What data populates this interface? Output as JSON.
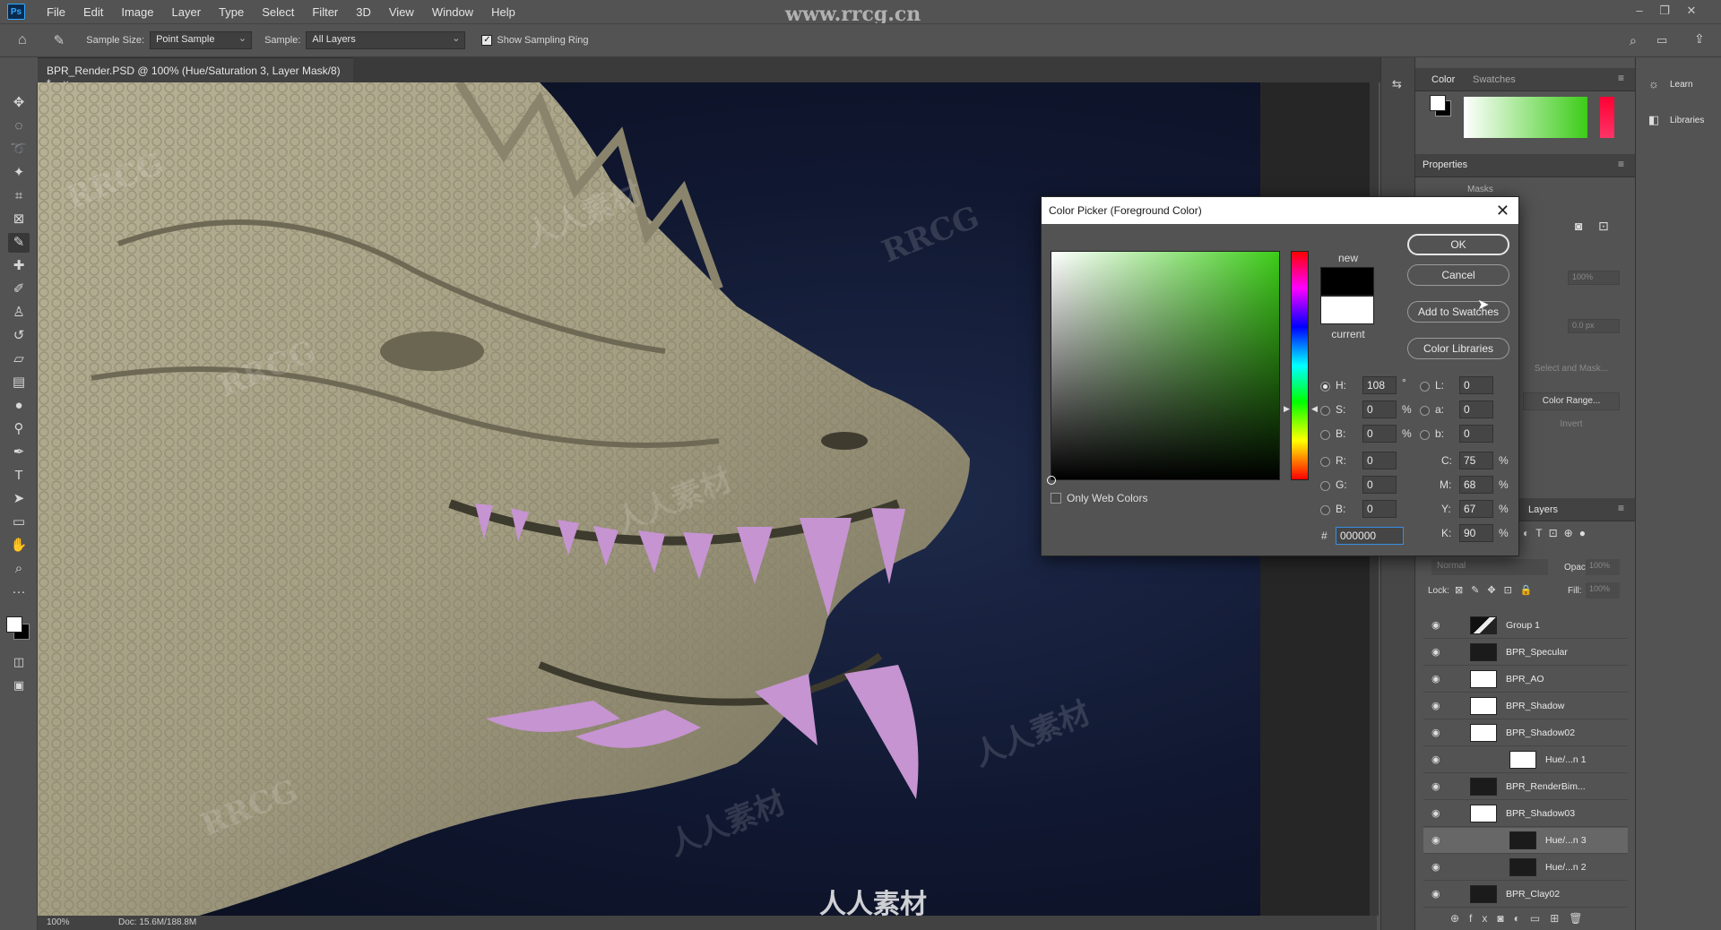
{
  "menu": {
    "logo": "Ps",
    "items": [
      "File",
      "Edit",
      "Image",
      "Layer",
      "Type",
      "Select",
      "Filter",
      "3D",
      "View",
      "Window",
      "Help"
    ],
    "watermark_url": "www.rrcg.cn"
  },
  "options": {
    "sample_size_label": "Sample Size:",
    "sample_size_value": "Point Sample",
    "sample_label": "Sample:",
    "sample_value": "All Layers",
    "show_ring_label": "Show Sampling Ring",
    "show_ring_checked": true
  },
  "document": {
    "tab_title": "BPR_Render.PSD @ 100% (Hue/Saturation 3, Layer Mask/8) *",
    "close": "×",
    "zoom": "100%",
    "doc_size": "Doc: 15.6M/188.8M"
  },
  "panels": {
    "color_tab": "Color",
    "swatches_tab": "Swatches",
    "properties_title": "Properties",
    "masks_label": "Masks",
    "learn": "Learn",
    "libraries": "Libraries",
    "layers_tab": "Layers",
    "props_density": "100%",
    "props_feather": "0.0 px",
    "select_and_mask": "Select and Mask...",
    "color_range": "Color Range...",
    "invert": "Invert",
    "blend_mode": "Normal",
    "opacity_label": "Opacity:",
    "opacity_value": "100%",
    "lock_label": "Lock:",
    "fill_label": "Fill:",
    "fill_value": "100%"
  },
  "layers": [
    {
      "name": "Group 1",
      "indent": 0,
      "thumb": "folder"
    },
    {
      "name": "BPR_Specular",
      "indent": 1,
      "thumb": "dark"
    },
    {
      "name": "BPR_AO",
      "indent": 1,
      "thumb": "white"
    },
    {
      "name": "BPR_Shadow",
      "indent": 1,
      "thumb": "white"
    },
    {
      "name": "BPR_Shadow02",
      "indent": 1,
      "thumb": "white"
    },
    {
      "name": "Hue/...n 1",
      "indent": 2,
      "thumb": "white"
    },
    {
      "name": "BPR_RenderBim...",
      "indent": 1,
      "thumb": "dark"
    },
    {
      "name": "BPR_Shadow03",
      "indent": 1,
      "thumb": "white"
    },
    {
      "name": "Hue/...n 3",
      "indent": 2,
      "thumb": "dark",
      "selected": true
    },
    {
      "name": "Hue/...n 2",
      "indent": 2,
      "thumb": "dark"
    },
    {
      "name": "BPR_Clay02",
      "indent": 1,
      "thumb": "dark"
    }
  ],
  "dialog": {
    "title": "Color Picker (Foreground Color)",
    "close": "✕",
    "ok": "OK",
    "cancel": "Cancel",
    "add_to_swatches": "Add to Swatches",
    "color_libraries": "Color Libraries",
    "new_label": "new",
    "current_label": "current",
    "new_color": "#000000",
    "current_color": "#ffffff",
    "only_web_colors": "Only Web Colors",
    "H": "108",
    "S": "0",
    "B": "0",
    "R": "0",
    "G": "0",
    "Bv": "0",
    "L": "0",
    "a": "0",
    "b": "0",
    "C": "75",
    "M": "68",
    "Y": "67",
    "K": "90",
    "hex": "000000",
    "deg": "°",
    "pct": "%",
    "hash": "#",
    "lbl_H": "H:",
    "lbl_S": "S:",
    "lbl_B": "B:",
    "lbl_R": "R:",
    "lbl_G": "G:",
    "lbl_Bv": "B:",
    "lbl_L": "L:",
    "lbl_a": "a:",
    "lbl_b": "b:",
    "lbl_C": "C:",
    "lbl_M": "M:",
    "lbl_Y": "Y:",
    "lbl_K": "K:"
  },
  "watermarks": {
    "rrcg": "RRCG",
    "cn": "人人素材",
    "footer": "人人素材"
  },
  "colors": {
    "accent": "#31a8ff",
    "hue_green": "#3dcc19",
    "tooth": "#c08ccc"
  }
}
